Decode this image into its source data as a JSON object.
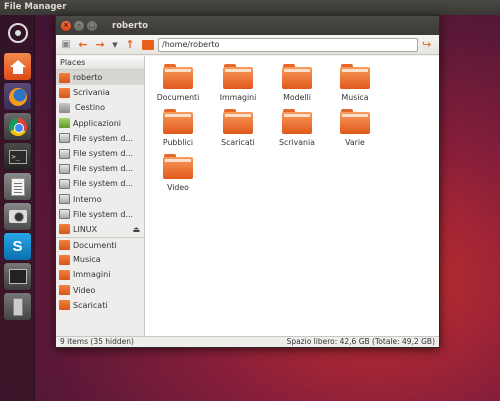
{
  "topbar": {
    "title": "File Manager"
  },
  "launcher": {
    "items": [
      {
        "name": "dash"
      },
      {
        "name": "home-folder"
      },
      {
        "name": "firefox"
      },
      {
        "name": "chrome"
      },
      {
        "name": "terminal"
      },
      {
        "name": "text-editor"
      },
      {
        "name": "camera"
      },
      {
        "name": "skype"
      },
      {
        "name": "system-monitor"
      },
      {
        "name": "usb-drive"
      }
    ],
    "terminal_glyph": ">_",
    "skype_glyph": "S"
  },
  "window": {
    "title": "roberto",
    "close_glyph": "×",
    "min_glyph": "–",
    "max_glyph": "□"
  },
  "toolbar": {
    "new_window_glyph": "▣",
    "back_glyph": "←",
    "forward_glyph": "→",
    "dropdown_glyph": "▼",
    "up_glyph": "↑",
    "path": "/home/roberto",
    "go_glyph": "↪"
  },
  "sidebar": {
    "header": "Places",
    "items": [
      {
        "label": "roberto",
        "icon": "folder-icon",
        "selected": true
      },
      {
        "label": "Scrivania",
        "icon": "folder-icon"
      },
      {
        "label": "Cestino",
        "icon": "trash-icon"
      },
      {
        "label": "Applicazioni",
        "icon": "apps-icon"
      },
      {
        "label": "File system d...",
        "icon": "drive-icon"
      },
      {
        "label": "File system d...",
        "icon": "drive-icon"
      },
      {
        "label": "File system d...",
        "icon": "drive-icon"
      },
      {
        "label": "File system d...",
        "icon": "drive-icon"
      },
      {
        "label": "Interno",
        "icon": "drive-icon"
      },
      {
        "label": "File system d...",
        "icon": "drive-icon"
      },
      {
        "label": "LINUX",
        "icon": "folder-icon",
        "eject": "⏏"
      },
      {
        "label": "Documenti",
        "icon": "folder-icon"
      },
      {
        "label": "Musica",
        "icon": "folder-icon"
      },
      {
        "label": "Immagini",
        "icon": "folder-icon"
      },
      {
        "label": "Video",
        "icon": "folder-icon"
      },
      {
        "label": "Scaricati",
        "icon": "folder-icon"
      }
    ]
  },
  "files": [
    {
      "label": "Documenti"
    },
    {
      "label": "Immagini"
    },
    {
      "label": "Modelli"
    },
    {
      "label": "Musica"
    },
    {
      "label": "Pubblici"
    },
    {
      "label": "Scaricati"
    },
    {
      "label": "Scrivania"
    },
    {
      "label": "Varie"
    },
    {
      "label": "Video"
    }
  ],
  "status": {
    "items": "9 items (35 hidden)",
    "space": "Spazio libero: 42,6 GB (Totale: 49,2 GB)"
  },
  "colors": {
    "accent": "#e2651f",
    "folder": "#e85f1c"
  }
}
